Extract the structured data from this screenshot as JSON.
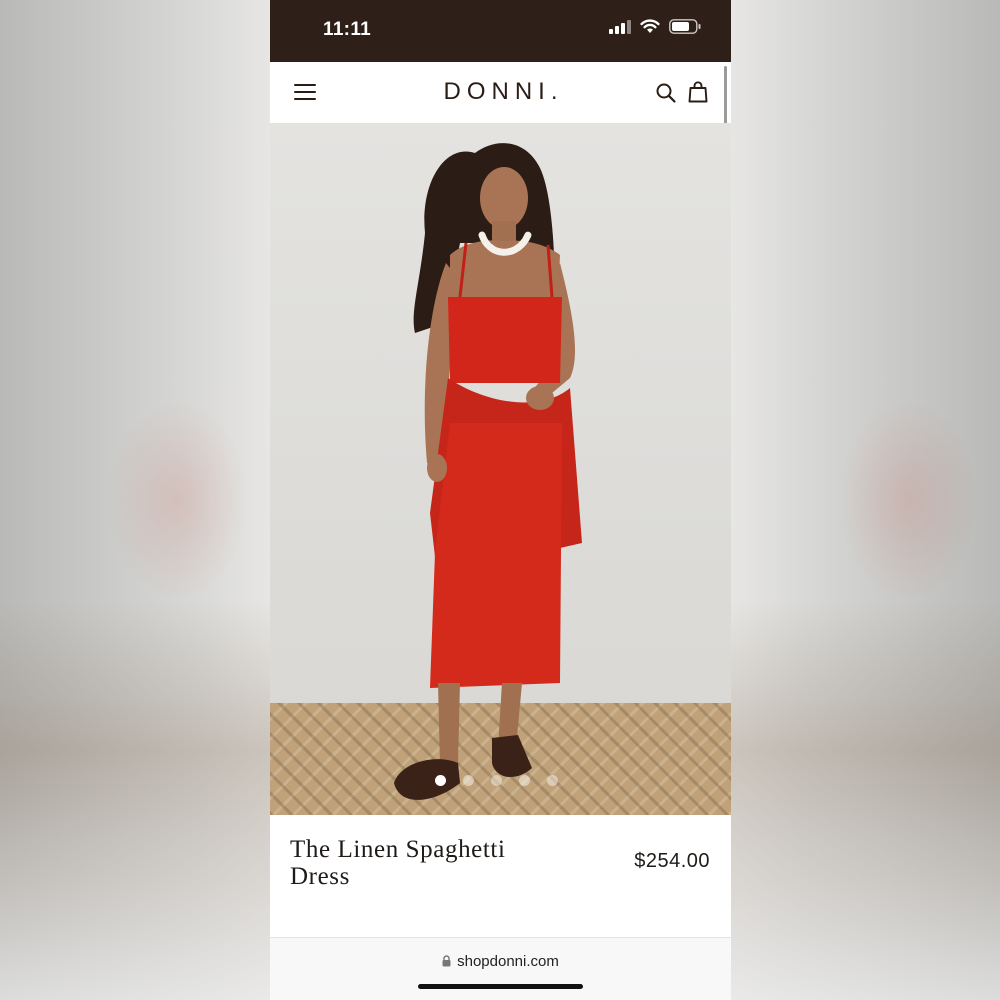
{
  "status_bar": {
    "time": "11:11",
    "icons": [
      "signal-icon",
      "wifi-icon",
      "battery-icon"
    ]
  },
  "nav": {
    "logo": "DONNI.",
    "menu_icon": "menu-icon",
    "search_icon": "search-icon",
    "cart_icon": "shopping-bag-icon"
  },
  "hero": {
    "slide_count": 5,
    "active_slide": 1
  },
  "product": {
    "title": "The Linen Spaghetti Dress",
    "price": "$254.00"
  },
  "browser": {
    "url": "shopdonni.com"
  },
  "colors": {
    "status_bar_bg": "#2e2018",
    "brand_text": "#2a1d16",
    "dress_red": "#d2261a"
  }
}
